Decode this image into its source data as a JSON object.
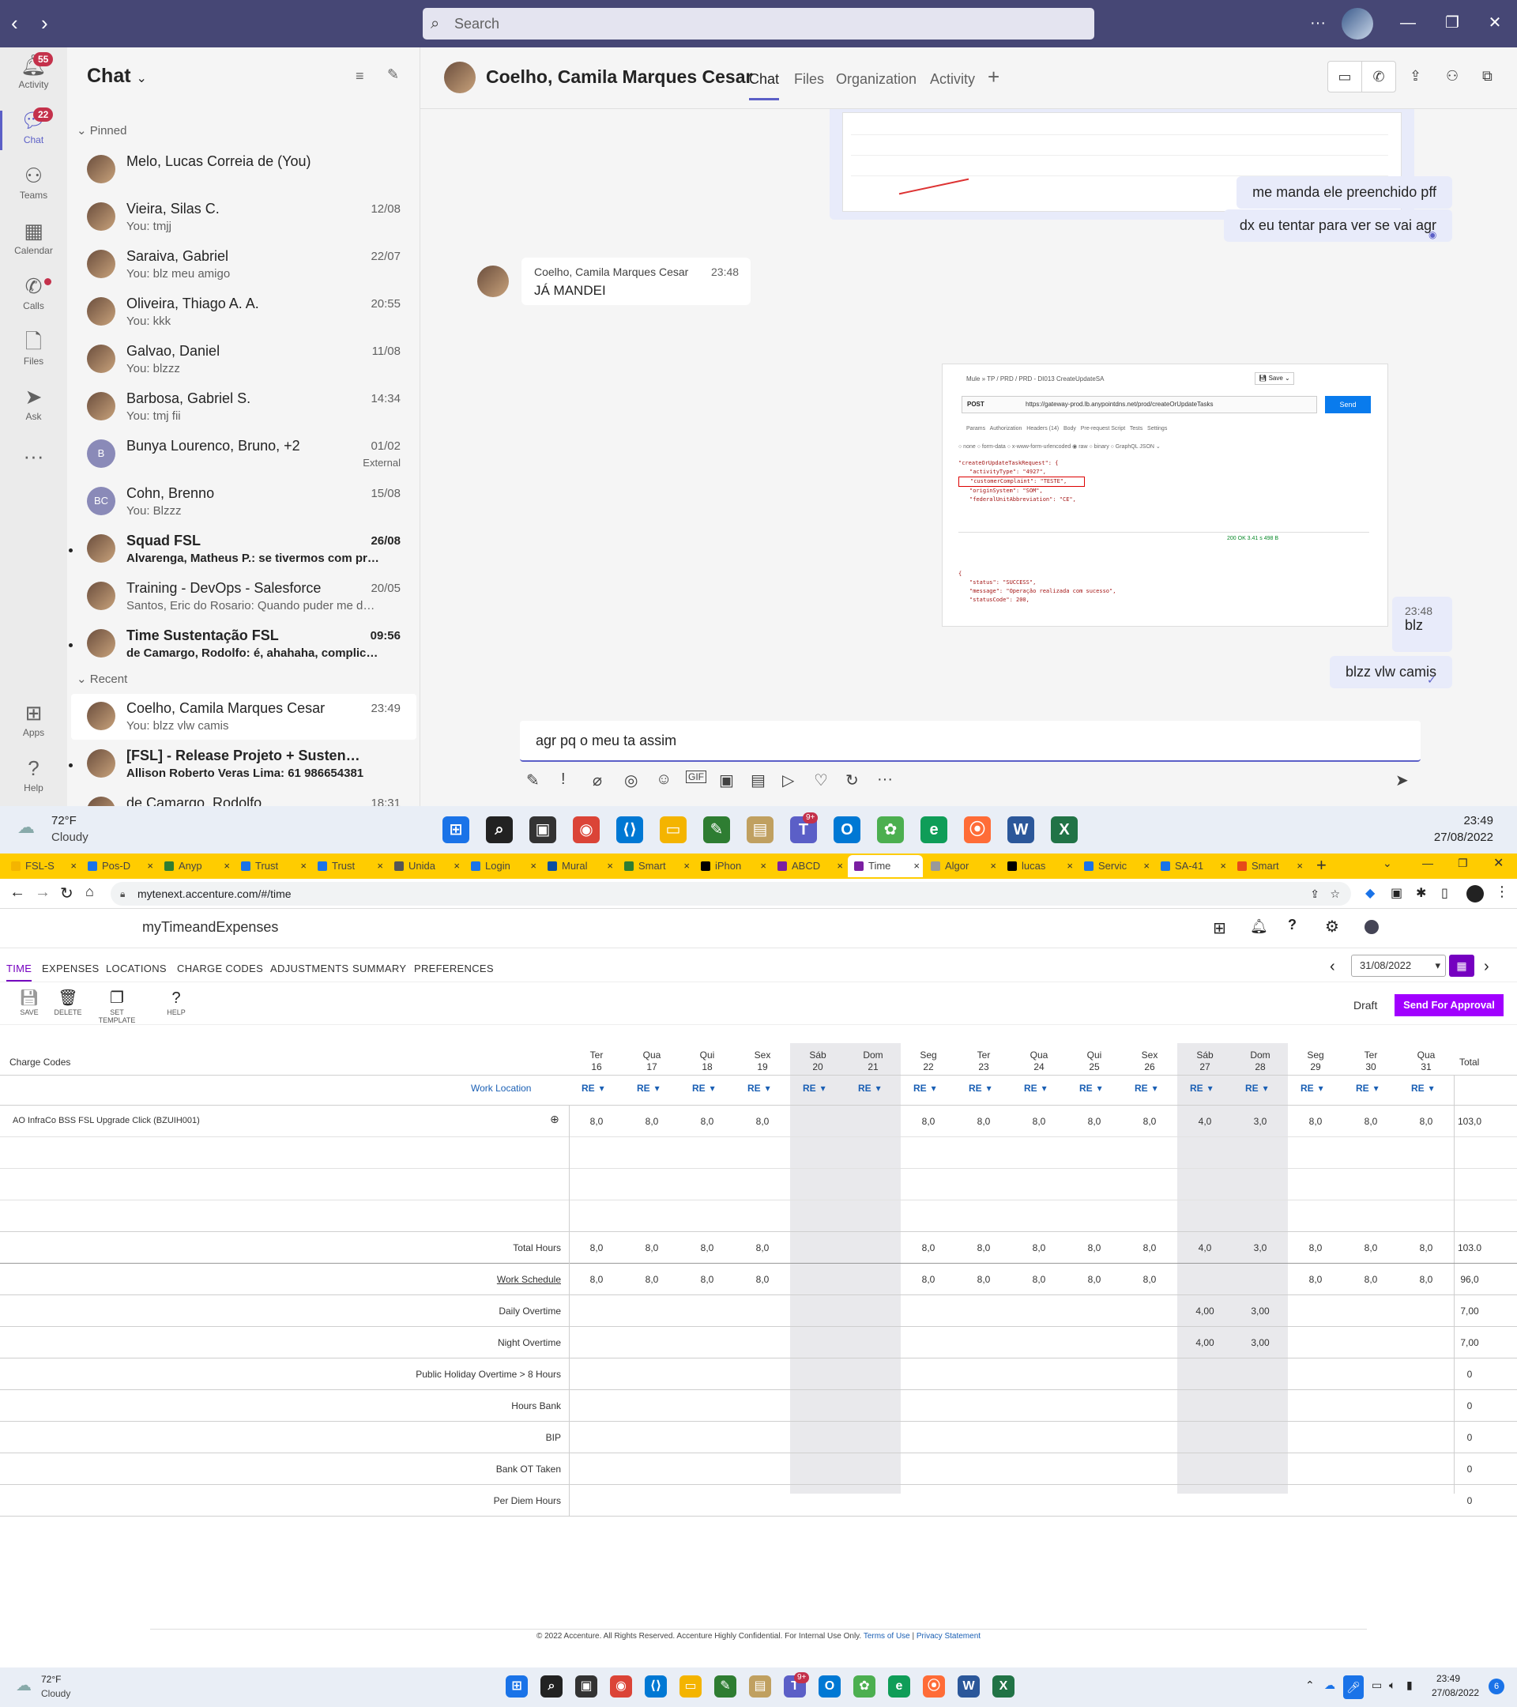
{
  "teams": {
    "search_placeholder": "Search",
    "rail": [
      {
        "label": "Activity",
        "badge": "55"
      },
      {
        "label": "Chat",
        "badge": "22"
      },
      {
        "label": "Teams"
      },
      {
        "label": "Calendar"
      },
      {
        "label": "Calls"
      },
      {
        "label": "Files"
      },
      {
        "label": "Ask"
      },
      {
        "label": "Apps"
      },
      {
        "label": "Help"
      }
    ],
    "list_title": "Chat",
    "pinned_label": "Pinned",
    "recent_label": "Recent",
    "chats": [
      {
        "name": "Melo, Lucas Correia de (You)",
        "preview": "",
        "time": ""
      },
      {
        "name": "Vieira, Silas C.",
        "preview": "You: tmjj",
        "time": "12/08"
      },
      {
        "name": "Saraiva, Gabriel",
        "preview": "You: blz meu amigo",
        "time": "22/07"
      },
      {
        "name": "Oliveira, Thiago A. A.",
        "preview": "You: kkk",
        "time": "20:55"
      },
      {
        "name": "Galvao, Daniel",
        "preview": "You: blzzz",
        "time": "11/08"
      },
      {
        "name": "Barbosa, Gabriel S.",
        "preview": "You: tmj fii",
        "time": "14:34"
      },
      {
        "name": "Bunya Lourenco, Bruno, +2",
        "preview": "",
        "time": "01/02",
        "extra": "External",
        "initials": "B"
      },
      {
        "name": "Cohn, Brenno",
        "preview": "You: Blzzz",
        "time": "15/08",
        "initials": "BC"
      },
      {
        "name": "Squad FSL",
        "preview": "Alvarenga, Matheus P.: se tivermos com problem...",
        "time": "26/08"
      },
      {
        "name": "Training - DevOps - Salesforce",
        "preview": "Santos, Eric do Rosario: Quando puder me dar u...",
        "time": "20/05"
      },
      {
        "name": "Time Sustentação FSL",
        "preview": "de Camargo, Rodolfo: é, ahahaha, complicado",
        "time": "09:56"
      }
    ],
    "recent_chats": [
      {
        "name": "Coelho, Camila Marques Cesar",
        "preview": "You: blzz vlw camis",
        "time": "23:49"
      },
      {
        "name": "[FSL] - Release Projeto + Sustentação -...",
        "preview": "Allison Roberto Veras Lima: 61 986654381",
        "time": ""
      },
      {
        "name": "de Camargo, Rodolfo",
        "preview": "",
        "time": "18:31"
      }
    ],
    "conversation": {
      "title": "Coelho, Camila Marques Cesar",
      "tabs": [
        "Chat",
        "Files",
        "Organization",
        "Activity"
      ],
      "messages": [
        {
          "dir": "out",
          "text": "me manda ele preenchido pff"
        },
        {
          "dir": "out",
          "text": "dx eu tentar para ver se vai agr"
        },
        {
          "dir": "in",
          "author": "Coelho, Camila Marques Cesar",
          "time": "23:48",
          "text": "JÁ MANDEI"
        },
        {
          "dir": "out",
          "time": "23:48",
          "text": "blz"
        },
        {
          "dir": "out",
          "text": "blzz vlw camis"
        }
      ],
      "compose_text": "agr pq o meu ta assim"
    },
    "embedded_request": {
      "breadcrumb": "Mule » TP / PRD / PRD - DI013 CreateUpdateSA",
      "method": "POST",
      "url": "https://gateway-prod.lb.anypointdns.net/prod/createOrUpdateTasks",
      "send": "Send",
      "tabs": "Params   Authorization   Headers (14)   Body   Pre-request Script   Tests   Settings",
      "body_lines": [
        "\"createOrUpdateTaskRequest\": {",
        "\"activityType\": \"4927\",",
        "\"customerComplaint\": \"TESTE\",",
        "\"originSystem\": \"SOM\",",
        "\"federalUnitAbbreviation\": \"CE\","
      ],
      "status": "200 OK  3.41 s  498 B",
      "response_lines": [
        "\"status\": \"SUCCESS\",",
        "\"message\": \"Operação realizada com sucesso\",",
        "\"statusCode\": 200,"
      ]
    }
  },
  "taskbar_top": {
    "weather_temp": "72°F",
    "weather_desc": "Cloudy",
    "time": "23:49",
    "date": "27/08/2022"
  },
  "browser": {
    "tabs": [
      "FSL-S",
      "Pos-D",
      "Anyp",
      "Trust",
      "Trust",
      "Unida",
      "Login",
      "Mural",
      "Smart",
      "iPhon",
      "ABCD",
      "Time",
      "Algor",
      "lucas",
      "Servic",
      "SA-41",
      "Smart"
    ],
    "url": "mytenext.accenture.com/#/time"
  },
  "app": {
    "title": "myTimeandExpenses",
    "nav": [
      "TIME",
      "EXPENSES",
      "LOCATIONS",
      "CHARGE CODES",
      "ADJUSTMENTS",
      "SUMMARY",
      "PREFERENCES"
    ],
    "date": "31/08/2022",
    "tools": [
      "SAVE",
      "DELETE",
      "SET TEMPLATE",
      "HELP"
    ],
    "status": "Draft",
    "approve": "Send For Approval",
    "charge_codes_label": "Charge Codes",
    "work_location_label": "Work Location",
    "total_label": "Total",
    "days": [
      {
        "d": "Ter",
        "n": "16"
      },
      {
        "d": "Qua",
        "n": "17"
      },
      {
        "d": "Qui",
        "n": "18"
      },
      {
        "d": "Sex",
        "n": "19"
      },
      {
        "d": "Sáb",
        "n": "20"
      },
      {
        "d": "Dom",
        "n": "21"
      },
      {
        "d": "Seg",
        "n": "22"
      },
      {
        "d": "Ter",
        "n": "23"
      },
      {
        "d": "Qua",
        "n": "24"
      },
      {
        "d": "Qui",
        "n": "25"
      },
      {
        "d": "Sex",
        "n": "26"
      },
      {
        "d": "Sáb",
        "n": "27"
      },
      {
        "d": "Dom",
        "n": "28"
      },
      {
        "d": "Seg",
        "n": "29"
      },
      {
        "d": "Ter",
        "n": "30"
      },
      {
        "d": "Qua",
        "n": "31"
      }
    ],
    "location_code": "RE",
    "charge_code": "AO InfraCo BSS FSL Upgrade Click (BZUIH001)",
    "charge_values": [
      "8,0",
      "8,0",
      "8,0",
      "8,0",
      "",
      "",
      "8,0",
      "8,0",
      "8,0",
      "8,0",
      "8,0",
      "4,0",
      "3,0",
      "8,0",
      "8,0",
      "8,0"
    ],
    "charge_total": "103,0",
    "summary_rows": [
      {
        "label": "Total Hours",
        "values": [
          "8,0",
          "8,0",
          "8,0",
          "8,0",
          "",
          "",
          "8,0",
          "8,0",
          "8,0",
          "8,0",
          "8,0",
          "4,0",
          "3,0",
          "8,0",
          "8,0",
          "8,0"
        ],
        "total": "103.0"
      },
      {
        "label": "Work Schedule",
        "values": [
          "8,0",
          "8,0",
          "8,0",
          "8,0",
          "",
          "",
          "8,0",
          "8,0",
          "8,0",
          "8,0",
          "8,0",
          "",
          "",
          "8,0",
          "8,0",
          "8,0"
        ],
        "total": "96,0"
      },
      {
        "label": "Daily Overtime",
        "values": [
          "",
          "",
          "",
          "",
          "",
          "",
          "",
          "",
          "",
          "",
          "",
          "4,00",
          "3,00",
          "",
          "",
          ""
        ],
        "total": "7,00"
      },
      {
        "label": "Night Overtime",
        "values": [
          "",
          "",
          "",
          "",
          "",
          "",
          "",
          "",
          "",
          "",
          "",
          "4,00",
          "3,00",
          "",
          "",
          ""
        ],
        "total": "7,00"
      },
      {
        "label": "Public Holiday Overtime > 8 Hours",
        "values": [],
        "total": "0"
      },
      {
        "label": "Hours Bank",
        "values": [],
        "total": "0"
      },
      {
        "label": "BIP",
        "values": [],
        "total": "0"
      },
      {
        "label": "Bank OT Taken",
        "values": [],
        "total": "0"
      },
      {
        "label": "Per Diem Hours",
        "values": [],
        "total": "0"
      }
    ],
    "footer": "© 2022 Accenture. All Rights Reserved. Accenture Highly Confidential. For Internal Use Only.",
    "footer_links": [
      "Terms of Use",
      "Privacy Statement"
    ]
  },
  "taskbar_bottom": {
    "weather_temp": "72°F",
    "weather_desc": "Cloudy",
    "time": "23:49",
    "date": "27/08/2022",
    "notif": "6"
  },
  "colors": {
    "teams_purple": "#464775",
    "accent": "#5b5fc7",
    "accenture_purple": "#a100ff",
    "tab_bar": "#ffcc00"
  }
}
